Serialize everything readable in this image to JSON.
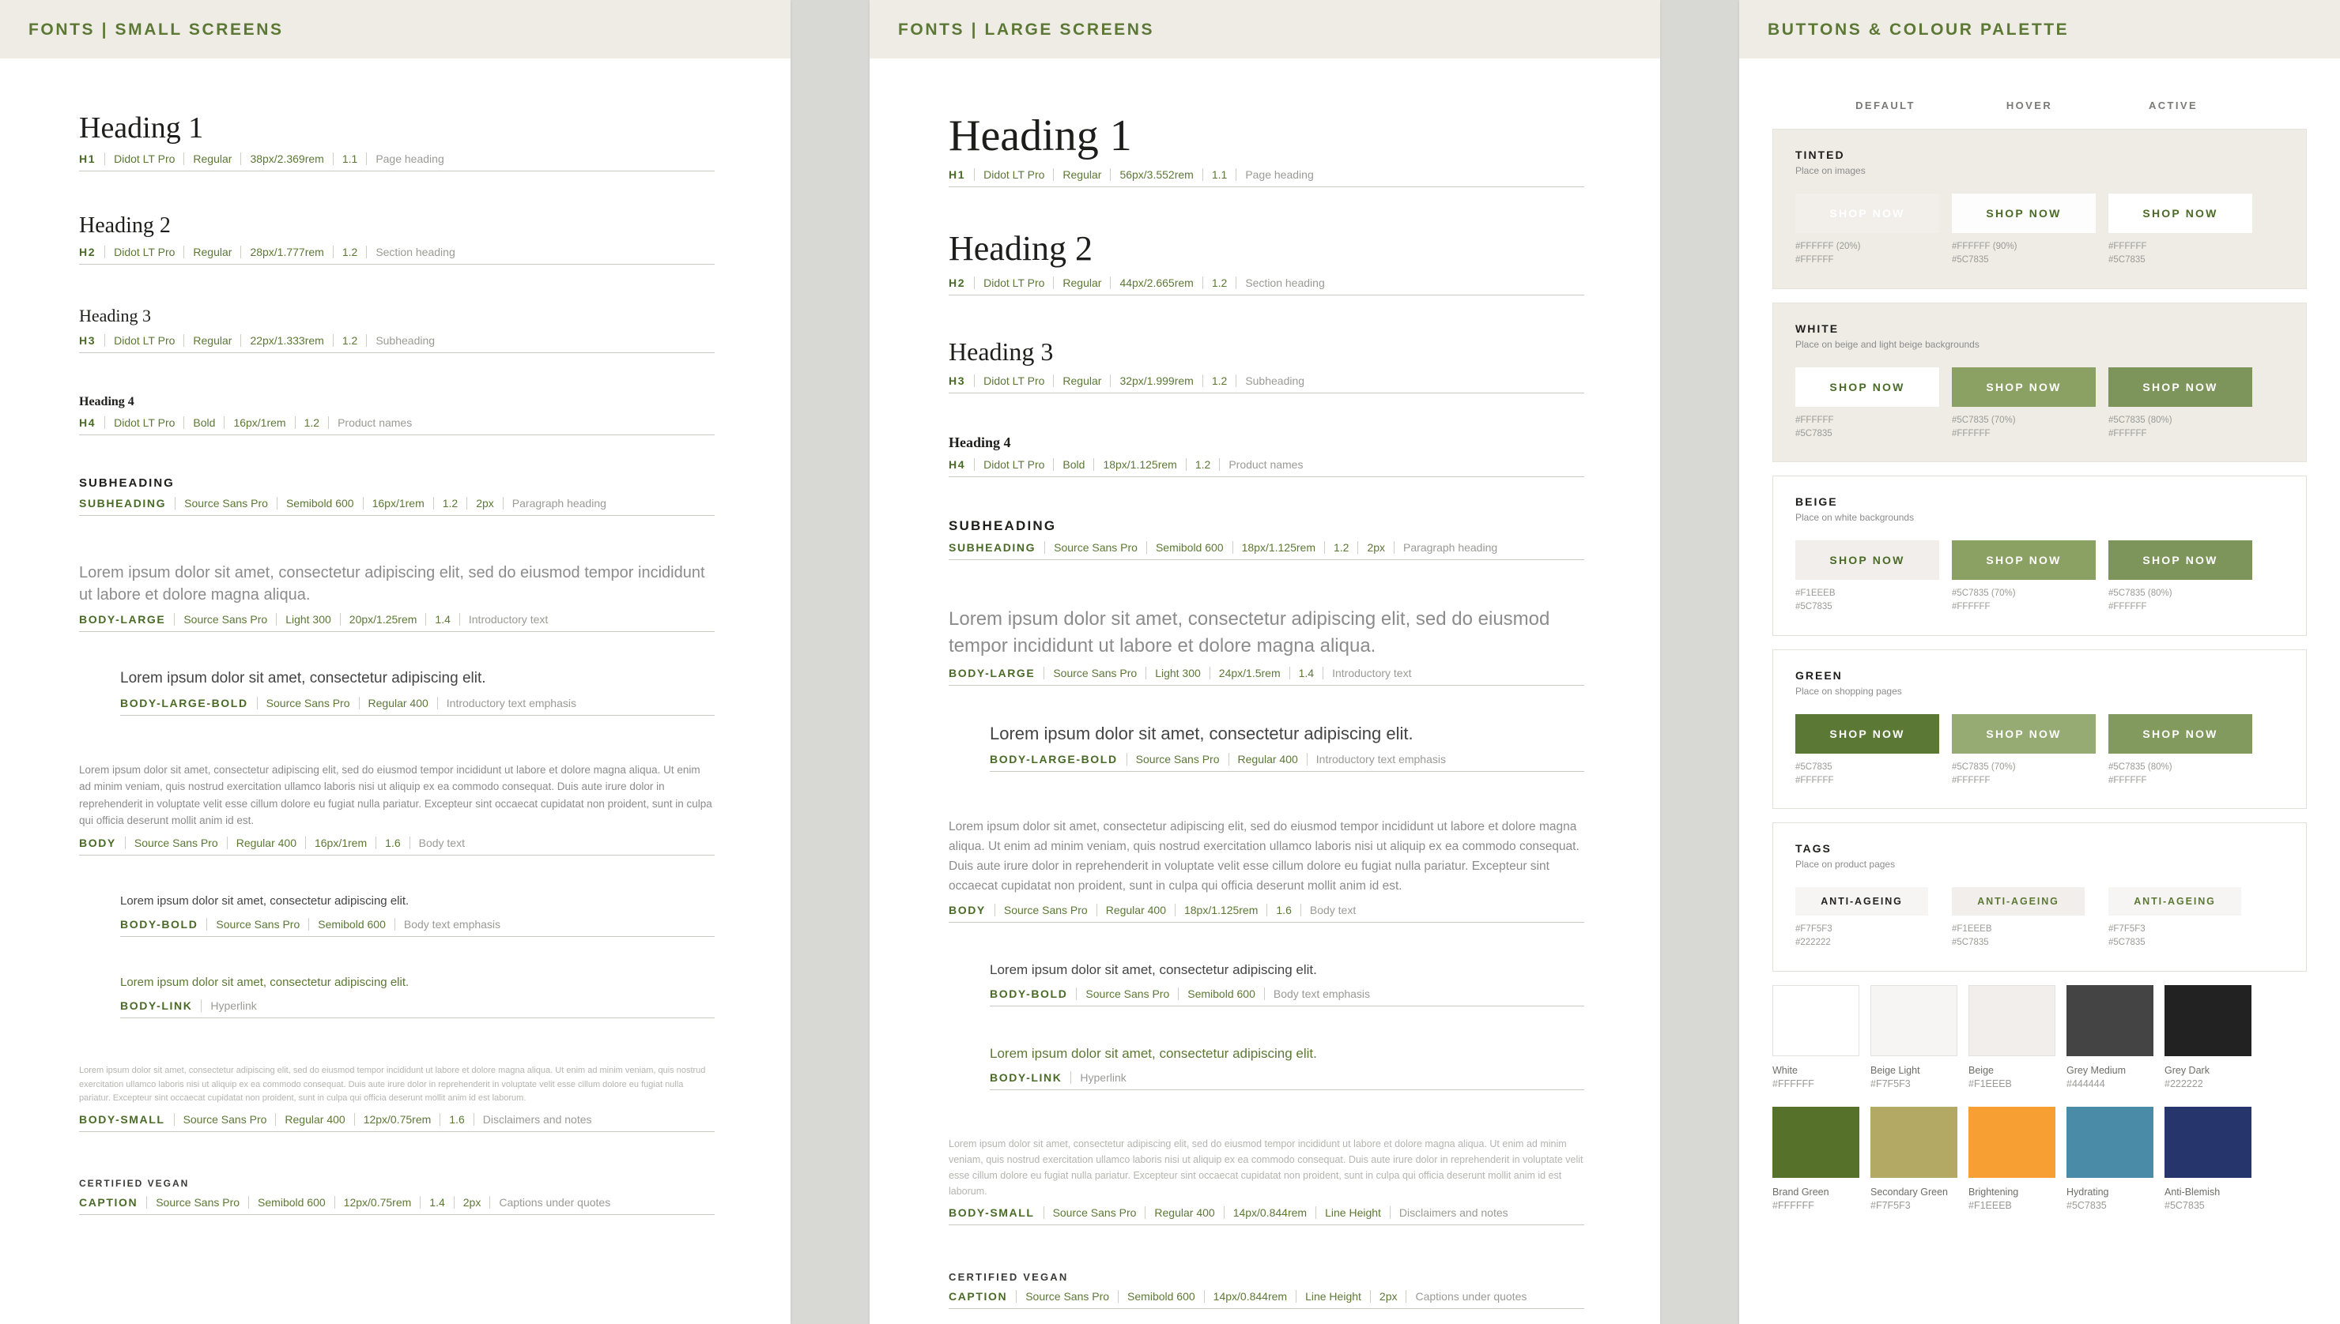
{
  "panels": {
    "small": {
      "title": "FONTS | SMALL SCREENS"
    },
    "large": {
      "title": "FONTS | LARGE SCREENS"
    },
    "right": {
      "title": "BUTTONS & COLOUR PALETTE"
    }
  },
  "labels": {
    "heading1": "Heading 1",
    "heading2": "Heading 2",
    "heading3": "Heading 3",
    "heading4": "Heading 4",
    "subheading": "SUBHEADING",
    "certified_vegan": "CERTIFIED VEGAN",
    "lorem_short": "Lorem ipsum dolor sit amet, consectetur adipiscing elit.",
    "lorem_large_small": "Lorem ipsum dolor sit amet, consectetur adipiscing elit, sed do eiusmod tempor incididunt ut labore et dolore magna aliqua.",
    "lorem_large_big": "Lorem ipsum dolor sit amet, consectetur adipiscing elit, sed do eiusmod tempor incididunt ut labore et dolore magna aliqua.",
    "lorem_body": "Lorem ipsum dolor sit amet, consectetur adipiscing elit, sed do eiusmod tempor incididunt ut labore et dolore magna aliqua. Ut enim ad minim veniam, quis nostrud exercitation ullamco laboris nisi ut aliquip ex ea commodo consequat. Duis aute irure dolor in reprehenderit in voluptate velit esse cillum dolore eu fugiat nulla pariatur. Excepteur sint occaecat cupidatat non proident, sunt in culpa qui officia deserunt mollit anim id est.",
    "lorem_small": "Lorem ipsum dolor sit amet, consectetur adipiscing elit, sed do eiusmod tempor incididunt ut labore et dolore magna aliqua. Ut enim ad minim veniam, quis nostrud exercitation ullamco laboris nisi ut aliquip ex ea commodo consequat. Duis aute irure dolor in reprehenderit in voluptate velit esse cillum dolore eu fugiat nulla pariatur. Excepteur sint occaecat cupidatat non proident, sunt in culpa qui officia deserunt mollit anim id est laborum."
  },
  "small_specs": {
    "h1": {
      "tag": "H1",
      "family": "Didot LT Pro",
      "weight": "Regular",
      "size": "38px/2.369rem",
      "lh": "1.1",
      "use": "Page heading"
    },
    "h2": {
      "tag": "H2",
      "family": "Didot LT Pro",
      "weight": "Regular",
      "size": "28px/1.777rem",
      "lh": "1.2",
      "use": "Section heading"
    },
    "h3": {
      "tag": "H3",
      "family": "Didot LT Pro",
      "weight": "Regular",
      "size": "22px/1.333rem",
      "lh": "1.2",
      "use": "Subheading"
    },
    "h4": {
      "tag": "H4",
      "family": "Didot LT Pro",
      "weight": "Bold",
      "size": "16px/1rem",
      "lh": "1.2",
      "use": "Product names"
    },
    "subheading": {
      "tag": "SUBHEADING",
      "family": "Source Sans Pro",
      "weight": "Semibold 600",
      "size": "16px/1rem",
      "lh": "1.2",
      "ls": "2px",
      "use": "Paragraph heading"
    },
    "body_large": {
      "tag": "BODY-LARGE",
      "family": "Source Sans Pro",
      "weight": "Light 300",
      "size": "20px/1.25rem",
      "lh": "1.4",
      "use": "Introductory text"
    },
    "body_large_bold": {
      "tag": "BODY-LARGE-BOLD",
      "family": "Source Sans Pro",
      "weight": "Regular 400",
      "use": "Introductory text emphasis"
    },
    "body": {
      "tag": "BODY",
      "family": "Source Sans Pro",
      "weight": "Regular 400",
      "size": "16px/1rem",
      "lh": "1.6",
      "use": "Body text"
    },
    "body_bold": {
      "tag": "BODY-BOLD",
      "family": "Source Sans Pro",
      "weight": "Semibold 600",
      "use": "Body text emphasis"
    },
    "body_link": {
      "tag": "BODY-LINK",
      "use": "Hyperlink"
    },
    "body_small": {
      "tag": "BODY-SMALL",
      "family": "Source Sans Pro",
      "weight": "Regular 400",
      "size": "12px/0.75rem",
      "lh": "1.6",
      "use": "Disclaimers and notes"
    },
    "caption": {
      "tag": "CAPTION",
      "family": "Source Sans Pro",
      "weight": "Semibold 600",
      "size": "12px/0.75rem",
      "lh": "1.4",
      "ls": "2px",
      "use": "Captions under quotes"
    }
  },
  "large_specs": {
    "h1": {
      "tag": "H1",
      "family": "Didot LT Pro",
      "weight": "Regular",
      "size": "56px/3.552rem",
      "lh": "1.1",
      "use": "Page heading"
    },
    "h2": {
      "tag": "H2",
      "family": "Didot LT Pro",
      "weight": "Regular",
      "size": "44px/2.665rem",
      "lh": "1.2",
      "use": "Section heading"
    },
    "h3": {
      "tag": "H3",
      "family": "Didot LT Pro",
      "weight": "Regular",
      "size": "32px/1.999rem",
      "lh": "1.2",
      "use": "Subheading"
    },
    "h4": {
      "tag": "H4",
      "family": "Didot LT Pro",
      "weight": "Bold",
      "size": "18px/1.125rem",
      "lh": "1.2",
      "use": "Product names"
    },
    "subheading": {
      "tag": "SUBHEADING",
      "family": "Source Sans Pro",
      "weight": "Semibold 600",
      "size": "18px/1.125rem",
      "lh": "1.2",
      "ls": "2px",
      "use": "Paragraph heading"
    },
    "body_large": {
      "tag": "BODY-LARGE",
      "family": "Source Sans Pro",
      "weight": "Light 300",
      "size": "24px/1.5rem",
      "lh": "1.4",
      "use": "Introductory text"
    },
    "body_large_bold": {
      "tag": "BODY-LARGE-BOLD",
      "family": "Source Sans Pro",
      "weight": "Regular 400",
      "use": "Introductory text emphasis"
    },
    "body": {
      "tag": "BODY",
      "family": "Source Sans Pro",
      "weight": "Regular 400",
      "size": "18px/1.125rem",
      "lh": "1.6",
      "use": "Body text"
    },
    "body_bold": {
      "tag": "BODY-BOLD",
      "family": "Source Sans Pro",
      "weight": "Semibold 600",
      "use": "Body text emphasis"
    },
    "body_link": {
      "tag": "BODY-LINK",
      "use": "Hyperlink"
    },
    "body_small": {
      "tag": "BODY-SMALL",
      "family": "Source Sans Pro",
      "weight": "Regular 400",
      "size": "14px/0.844rem",
      "lh": "Line Height",
      "use": "Disclaimers and notes"
    },
    "caption": {
      "tag": "CAPTION",
      "family": "Source Sans Pro",
      "weight": "Semibold 600",
      "size": "14px/0.844rem",
      "lh": "Line Height",
      "ls": "2px",
      "use": "Captions under quotes"
    }
  },
  "buttons": {
    "columns": [
      "DEFAULT",
      "HOVER",
      "ACTIVE"
    ],
    "shop_now": "SHOP NOW",
    "tag_label": "ANTI-AGEING",
    "groups": [
      {
        "name": "TINTED",
        "note": "Place on images",
        "panel_bg": "#efece6",
        "states": [
          {
            "bg": "rgba(255,255,255,0.20)",
            "fg": "#ffffff",
            "hex_bg": "#FFFFFF (20%)",
            "hex_fg": "#FFFFFF"
          },
          {
            "bg": "rgba(255,255,255,0.90)",
            "fg": "#4a6b27",
            "hex_bg": "#FFFFFF (90%)",
            "hex_fg": "#5C7835"
          },
          {
            "bg": "#FFFFFF",
            "fg": "#4a6b27",
            "hex_bg": "#FFFFFF",
            "hex_fg": "#5C7835"
          }
        ]
      },
      {
        "name": "WHITE",
        "note": "Place on beige and light beige backgrounds",
        "panel_bg": "#efece6",
        "states": [
          {
            "bg": "#FFFFFF",
            "fg": "#4a6b27",
            "hex_bg": "#FFFFFF",
            "hex_fg": "#5C7835"
          },
          {
            "bg": "#8ba163",
            "fg": "#FFFFFF",
            "hex_bg": "#5C7835 (70%)",
            "hex_fg": "#FFFFFF"
          },
          {
            "bg": "#7d955a",
            "fg": "#FFFFFF",
            "hex_bg": "#5C7835 (80%)",
            "hex_fg": "#FFFFFF"
          }
        ]
      },
      {
        "name": "BEIGE",
        "note": "Place on white backgrounds",
        "panel_bg": "#ffffff",
        "states": [
          {
            "bg": "#F1EEEB",
            "fg": "#4a6b27",
            "hex_bg": "#F1EEEB",
            "hex_fg": "#5C7835"
          },
          {
            "bg": "#8ba163",
            "fg": "#FFFFFF",
            "hex_bg": "#5C7835 (70%)",
            "hex_fg": "#FFFFFF"
          },
          {
            "bg": "#7d955a",
            "fg": "#FFFFFF",
            "hex_bg": "#5C7835 (80%)",
            "hex_fg": "#FFFFFF"
          }
        ]
      },
      {
        "name": "GREEN",
        "note": "Place on shopping pages",
        "panel_bg": "#ffffff",
        "states": [
          {
            "bg": "#5C7835",
            "fg": "#FFFFFF",
            "hex_bg": "#5C7835",
            "hex_fg": "#FFFFFF"
          },
          {
            "bg": "#95ab73",
            "fg": "#FFFFFF",
            "hex_bg": "#5C7835 (70%)",
            "hex_fg": "#FFFFFF"
          },
          {
            "bg": "#829a5e",
            "fg": "#FFFFFF",
            "hex_bg": "#5C7835 (80%)",
            "hex_fg": "#FFFFFF"
          }
        ]
      }
    ],
    "tags_group": {
      "name": "TAGS",
      "note": "Place on product pages",
      "states": [
        {
          "bg": "#F7F5F3",
          "fg": "#222222",
          "hex_bg": "#F7F5F3",
          "hex_fg": "#222222"
        },
        {
          "bg": "#F1EEEB",
          "fg": "#5C7835",
          "hex_bg": "#F1EEEB",
          "hex_fg": "#5C7835"
        },
        {
          "bg": "#F7F5F3",
          "fg": "#5C7835",
          "hex_bg": "#F7F5F3",
          "hex_fg": "#5C7835"
        }
      ]
    }
  },
  "palette": {
    "row1": [
      {
        "name": "White",
        "code": "#FFFFFF",
        "swatch": "#FFFFFF",
        "border": true
      },
      {
        "name": "Beige Light",
        "code": "#F7F5F3",
        "swatch": "#F7F5F3",
        "border": true
      },
      {
        "name": "Beige",
        "code": "#F1EEEB",
        "swatch": "#F1EEEB",
        "border": true
      },
      {
        "name": "Grey Medium",
        "code": "#444444",
        "swatch": "#444444",
        "border": false
      },
      {
        "name": "Grey Dark",
        "code": "#222222",
        "swatch": "#222222",
        "border": false
      }
    ],
    "row2": [
      {
        "name": "Brand Green",
        "code": "#FFFFFF",
        "swatch": "#567129",
        "border": false
      },
      {
        "name": "Secondary Green",
        "code": "#F7F5F3",
        "swatch": "#b3a965",
        "border": false
      },
      {
        "name": "Brightening",
        "code": "#F1EEEB",
        "swatch": "#f79f33",
        "border": false
      },
      {
        "name": "Hydrating",
        "code": "#5C7835",
        "swatch": "#4a8ca8",
        "border": false
      },
      {
        "name": "Anti-Blemish",
        "code": "#5C7835",
        "swatch": "#26356b",
        "border": false
      }
    ]
  }
}
